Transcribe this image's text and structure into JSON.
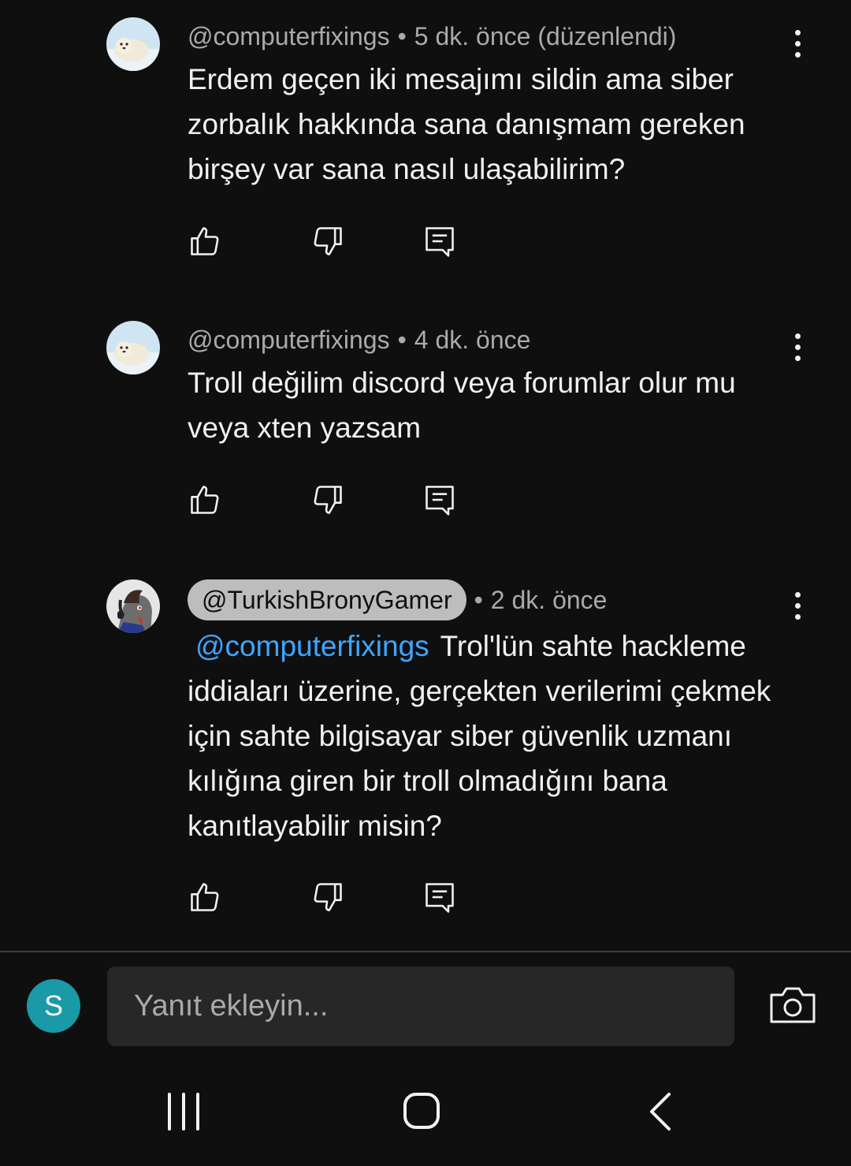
{
  "comments": [
    {
      "author": "@computerfixings",
      "separator": "•",
      "time": "5 dk. önce (düzenlendi)",
      "text": "Erdem geçen iki mesajımı sildin ama siber zorbalık hakkında sana danışmam gereken birşey var sana nasıl ulaşabilirim?",
      "avatar_icon": "seal-avatar-icon",
      "highlighted_author": false
    },
    {
      "author": "@computerfixings",
      "separator": "•",
      "time": "4 dk. önce",
      "text": "Troll değilim discord veya forumlar olur mu veya xten yazsam",
      "avatar_icon": "seal-avatar-icon",
      "highlighted_author": false
    },
    {
      "author": "@TurkishBronyGamer",
      "separator": "•",
      "time": "2 dk. önce",
      "mention": "@computerfixings",
      "text": "Trol'lün sahte hackleme iddiaları üzerine, gerçekten verilerimi çekmek için sahte bilgisayar siber güvenlik uzmanı kılığına giren bir troll olmadığını bana kanıtlayabilir misin?",
      "avatar_icon": "pony-avatar-icon",
      "highlighted_author": true
    }
  ],
  "reply": {
    "user_initial": "S",
    "placeholder": "Yanıt ekleyin...",
    "avatar_color": "#1a9aa6"
  },
  "colors": {
    "background": "#0f0f0f",
    "mention": "#3ea6ff",
    "meta": "#aaaaaa"
  }
}
